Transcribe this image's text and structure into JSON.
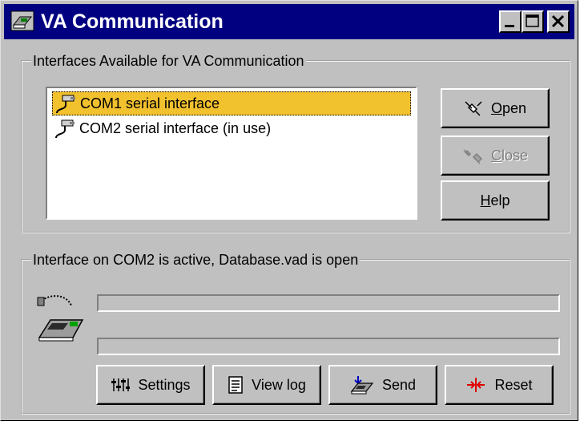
{
  "window": {
    "title": "VA Communication",
    "title_bar_color": "#000080",
    "controls": [
      "minimize-icon",
      "maximize-icon",
      "close-icon"
    ]
  },
  "interfaces_group": {
    "legend": "Interfaces Available for VA Communication",
    "items": [
      {
        "label": "COM1 serial interface",
        "icon": "serial-cable-icon",
        "selected": true
      },
      {
        "label": "COM2 serial interface (in use)",
        "icon": "serial-cable-icon",
        "selected": false
      }
    ],
    "selection_color": "#f2c12e",
    "buttons": {
      "open": {
        "mnemonic": "O",
        "rest": "pen",
        "icon": "plug-connect-icon",
        "enabled": true
      },
      "close": {
        "mnemonic": "C",
        "rest": "lose",
        "icon": "plug-disconnect-icon",
        "enabled": false
      },
      "help": {
        "mnemonic": "H",
        "rest": "elp",
        "enabled": true
      }
    }
  },
  "status_group": {
    "legend": "Interface on COM2 is active, Database.vad is open",
    "device_icon": "handheld-device-icon",
    "progress_top": 0,
    "progress_bottom": 0,
    "buttons": {
      "settings": {
        "label": "Settings",
        "icon": "sliders-icon"
      },
      "view_log": {
        "label": "View log",
        "icon": "notepad-icon"
      },
      "send": {
        "label": "Send",
        "icon": "send-icon"
      },
      "reset": {
        "label": "Reset",
        "icon": "reset-arrows-icon"
      }
    }
  }
}
